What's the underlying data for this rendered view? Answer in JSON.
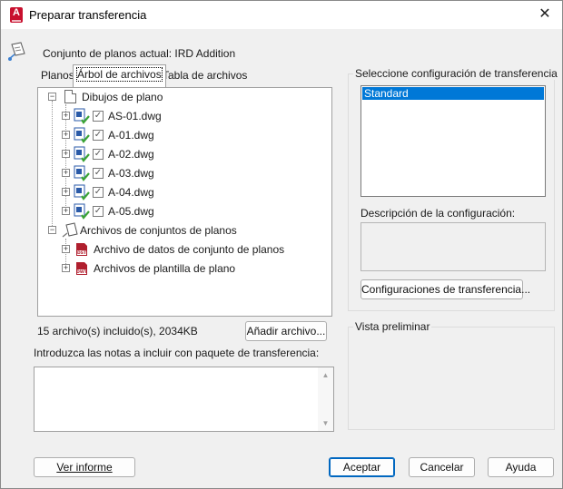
{
  "window": {
    "title": "Preparar transferencia",
    "close_glyph": "✕"
  },
  "header": {
    "current_set_label": "Conjunto de planos actual: IRD Addition"
  },
  "tabs": [
    {
      "label": "Planos",
      "active": false
    },
    {
      "label": "Árbol de archivos",
      "active": true
    },
    {
      "label": "Tabla de archivos",
      "active": false
    }
  ],
  "tree": {
    "group1": {
      "label": "Dibujos de plano",
      "files": [
        "AS-01.dwg",
        "A-01.dwg",
        "A-02.dwg",
        "A-03.dwg",
        "A-04.dwg",
        "A-05.dwg"
      ]
    },
    "group2": {
      "label": "Archivos de conjuntos de planos",
      "items": [
        {
          "label": "Archivo de datos de conjunto de planos",
          "icon_text": "DST"
        },
        {
          "label": "Archivos de plantilla de plano",
          "icon_text": "DWT"
        }
      ]
    }
  },
  "status": {
    "summary": "15 archivo(s) incluido(s), 2034KB",
    "add_file_button": "Añadir archivo..."
  },
  "notes": {
    "label": "Introduzca las notas a incluir con paquete de transferencia:",
    "value": ""
  },
  "transfer_config": {
    "group_label": "Seleccione configuración de transferencia",
    "options": [
      "Standard"
    ],
    "selected": "Standard",
    "description_label": "Descripción de la configuración:",
    "description_value": "",
    "configs_button": "Configuraciones de transferencia..."
  },
  "preview": {
    "group_label": "Vista preliminar"
  },
  "footer": {
    "view_report": "Ver informe",
    "ok": "Aceptar",
    "cancel": "Cancelar",
    "help": "Ayuda"
  },
  "colors": {
    "accent": "#0078d7",
    "brand": "#c8102e",
    "check_green": "#3aa335"
  }
}
